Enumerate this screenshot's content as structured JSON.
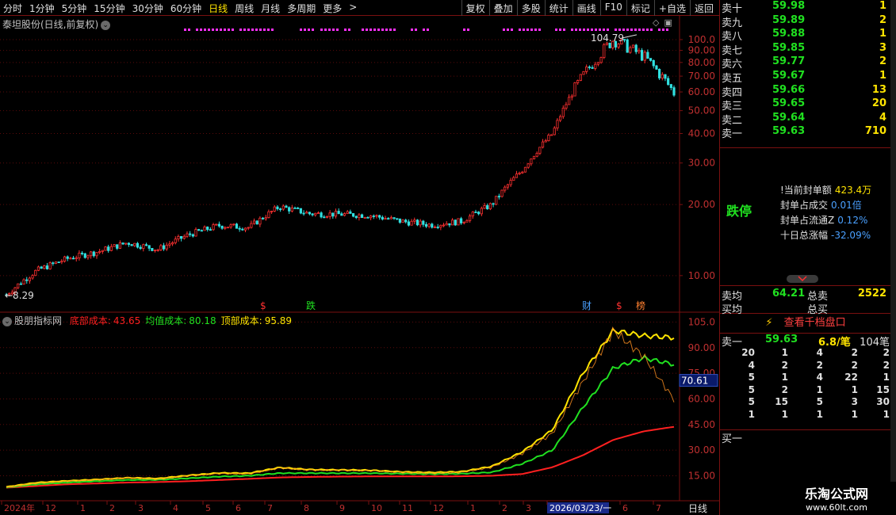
{
  "toolbar": {
    "tabs": [
      "分时",
      "1分钟",
      "5分钟",
      "15分钟",
      "30分钟",
      "60分钟",
      "日线",
      "周线",
      "月线",
      "多周期",
      "更多"
    ],
    "active_tab": "日线",
    "buttons": [
      "复权",
      "叠加",
      "多股",
      "统计",
      "画线",
      "F10",
      "标记",
      "+自选",
      "返回"
    ]
  },
  "main_chart": {
    "title": "泰坦股份(日线,前复权)",
    "high_label": "104.79",
    "low_label": "8.29",
    "y_ticks": [
      "100.0",
      "90.00",
      "80.00",
      "70.00",
      "60.00",
      "50.00",
      "40.00",
      "30.00",
      "20.00",
      "10.00"
    ],
    "markers": [
      "$",
      "跌",
      "财",
      "$",
      "榜"
    ]
  },
  "indicator": {
    "name": "股朋指标网",
    "items": [
      {
        "label": "底部成本:",
        "value": "43.65",
        "color": "#ff2020"
      },
      {
        "label": "均值成本:",
        "value": "80.18",
        "color": "#20e020"
      },
      {
        "label": "顶部成本:",
        "value": "95.89",
        "color": "#ffe400"
      }
    ],
    "y_ticks": [
      "105.0",
      "90.00",
      "75.00",
      "60.00",
      "45.00",
      "30.00",
      "15.00"
    ],
    "cursor_value": "70.61"
  },
  "x_axis": {
    "labels": [
      "2024年",
      "12",
      "1",
      "2",
      "3",
      "4",
      "5",
      "6",
      "7",
      "8",
      "9",
      "10",
      "11",
      "12",
      "1",
      "2",
      "3",
      "2026/03/23/一",
      "6",
      "7"
    ],
    "period": "日线"
  },
  "chart_data": {
    "type": "line",
    "x_labels": [
      "2024年",
      "12",
      "1",
      "2",
      "3",
      "4",
      "5",
      "6",
      "7",
      "8",
      "9",
      "10",
      "11",
      "12",
      "1",
      "2",
      "3",
      "4",
      "5",
      "6",
      "7"
    ],
    "price_close": [
      8.3,
      10.5,
      11.8,
      12.6,
      13.8,
      12.9,
      14.9,
      16.3,
      16.0,
      19.6,
      18.3,
      18.2,
      18.0,
      17.0,
      16.4,
      17.0,
      20.0,
      28.0,
      40.0,
      70.0,
      100.0,
      85.0,
      59.63
    ],
    "series": [
      {
        "name": "底部成本",
        "values": [
          8.0,
          9.0,
          10.0,
          10.5,
          11.0,
          11.3,
          11.8,
          12.5,
          13.2,
          14.0,
          14.3,
          14.5,
          14.6,
          14.6,
          14.6,
          14.7,
          15.0,
          16.0,
          20.0,
          27.0,
          36.0,
          41.0,
          43.65
        ]
      },
      {
        "name": "均值成本",
        "values": [
          8.2,
          10.0,
          11.0,
          11.8,
          12.5,
          12.6,
          13.5,
          14.5,
          15.0,
          16.5,
          16.5,
          16.5,
          16.5,
          16.2,
          16.0,
          16.2,
          17.0,
          22.0,
          30.0,
          55.0,
          78.0,
          84.0,
          80.18
        ]
      },
      {
        "name": "顶部成本",
        "values": [
          8.5,
          11.0,
          12.0,
          12.8,
          13.8,
          13.4,
          15.2,
          16.6,
          16.5,
          19.8,
          18.6,
          18.4,
          18.2,
          17.3,
          16.9,
          17.4,
          20.5,
          29.0,
          42.0,
          75.0,
          100.0,
          97.0,
          95.89
        ]
      }
    ],
    "ylim": [
      5,
      108
    ]
  },
  "order_book": {
    "asks": [
      {
        "label": "卖十",
        "price": "59.98",
        "vol": "1"
      },
      {
        "label": "卖九",
        "price": "59.89",
        "vol": "2"
      },
      {
        "label": "卖八",
        "price": "59.88",
        "vol": "1"
      },
      {
        "label": "卖七",
        "price": "59.85",
        "vol": "3"
      },
      {
        "label": "卖六",
        "price": "59.77",
        "vol": "2"
      },
      {
        "label": "卖五",
        "price": "59.67",
        "vol": "1"
      },
      {
        "label": "卖四",
        "price": "59.66",
        "vol": "13"
      },
      {
        "label": "卖三",
        "price": "59.65",
        "vol": "20"
      },
      {
        "label": "卖二",
        "price": "59.64",
        "vol": "4"
      },
      {
        "label": "卖一",
        "price": "59.63",
        "vol": "710"
      }
    ]
  },
  "limit_info": {
    "status": "跌停",
    "lines": [
      {
        "k": "!当前封单额",
        "v": "423.4万"
      },
      {
        "k": "封单占成交",
        "v": "0.01倍"
      },
      {
        "k": "封单占流通Z",
        "v": "0.12%"
      },
      {
        "k": "十日总涨幅",
        "v": "-32.09%"
      }
    ]
  },
  "avg": {
    "sell_avg_label": "卖均",
    "sell_avg": "64.21",
    "buy_avg_label": "买均",
    "total_sell_label": "总卖",
    "total_sell": "2522",
    "total_buy_label": "总买"
  },
  "depth_button": "查看千档盘口",
  "queue": {
    "label": "卖一",
    "price": "59.63",
    "per": "6.8/笔",
    "count": "104笔",
    "rows": [
      [
        "20",
        "1",
        "4",
        "2",
        "2"
      ],
      [
        "4",
        "2",
        "2",
        "2",
        "2"
      ],
      [
        "5",
        "1",
        "4",
        "22",
        "1"
      ],
      [
        "5",
        "2",
        "1",
        "1",
        "15"
      ],
      [
        "5",
        "15",
        "5",
        "3",
        "30"
      ],
      [
        "1",
        "1",
        "1",
        "1",
        "1"
      ]
    ],
    "buy1_label": "买一"
  },
  "watermark": {
    "line1": "乐淘公式网",
    "line2": "www.60lt.com"
  }
}
